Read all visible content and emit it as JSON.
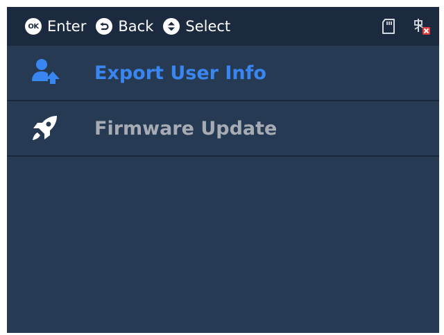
{
  "topbar": {
    "hints": [
      {
        "icon": "ok-icon",
        "label": "Enter"
      },
      {
        "icon": "back-icon",
        "label": "Back"
      },
      {
        "icon": "select-updown-icon",
        "label": "Select"
      }
    ],
    "status_icons": [
      "sd-card-icon",
      "usb-disconnected-icon"
    ]
  },
  "menu": {
    "items": [
      {
        "label": "Export User Info",
        "icon": "user-export-icon",
        "selected": true
      },
      {
        "label": "Firmware Update",
        "icon": "rocket-icon",
        "selected": false
      }
    ]
  },
  "colors": {
    "background": "#263a54",
    "topbar": "#1b2a3e",
    "selected_text": "#3a86f0",
    "normal_text": "#a7acb4"
  }
}
